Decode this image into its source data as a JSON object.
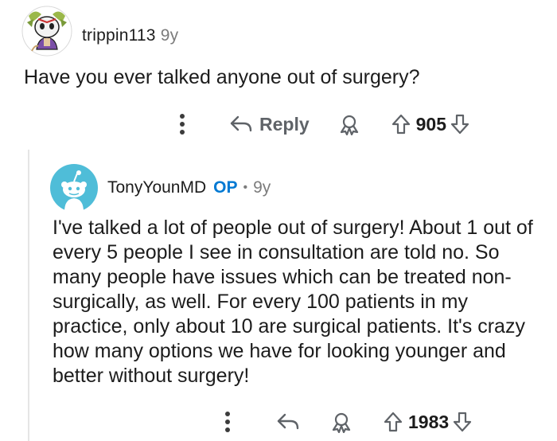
{
  "top_comment": {
    "username": "trippin113",
    "age": "9y",
    "body": "Have you ever talked anyone out of surgery?",
    "reply_label": "Reply",
    "vote_count": "905"
  },
  "reply_comment": {
    "username": "TonyYounMD",
    "op_badge": "OP",
    "separator": "•",
    "age": "9y",
    "body": "I've talked a lot of people out of surgery! About 1 out of every 5 people I see in consultation are told no. So many people have issues which can be treated non-surgically, as well. For every 100 patients in my practice, only about 10 are surgical patients. It's crazy how many options we have for looking younger and better without surgery!",
    "vote_count": "1983"
  },
  "colors": {
    "op_blue": "#0079d3",
    "meta_gray": "#7c7c7c",
    "icon_gray": "#5f6368",
    "avatar_blue": "#4fbdd8"
  },
  "icons": [
    "more-icon",
    "reply-icon",
    "award-icon",
    "upvote-icon",
    "downvote-icon"
  ]
}
